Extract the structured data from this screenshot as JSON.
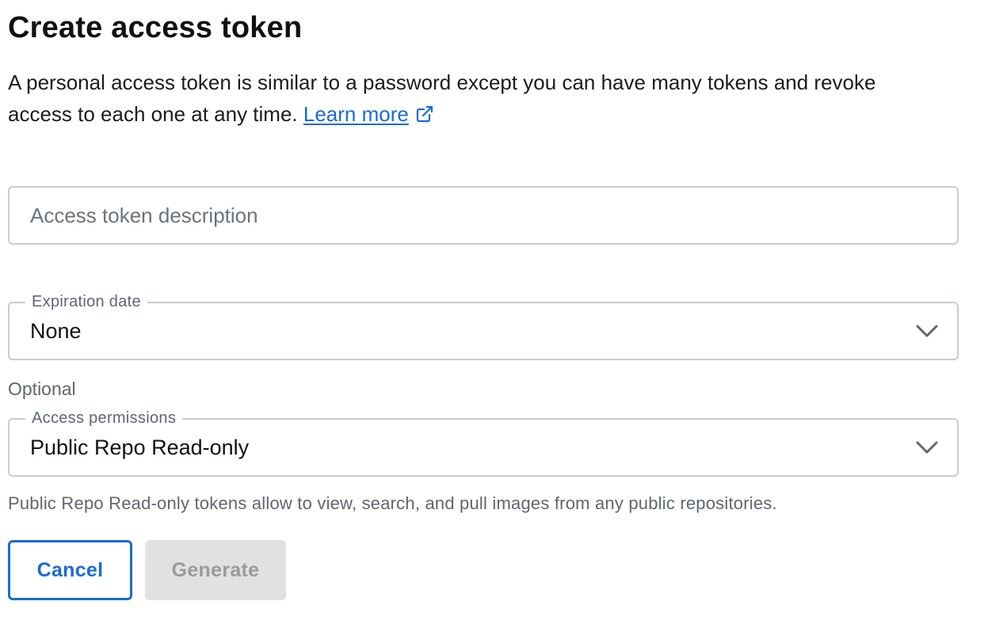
{
  "header": {
    "title": "Create access token"
  },
  "intro": {
    "text": "A personal access token is similar to a password except you can have many tokens and revoke access to each one at any time.",
    "link_label": "Learn more",
    "link_icon": "external-link-icon"
  },
  "form": {
    "description": {
      "placeholder": "Access token description",
      "value": ""
    },
    "expiration": {
      "label": "Expiration date",
      "value": "None",
      "icon": "chevron-down-icon"
    },
    "optional_label": "Optional",
    "permissions": {
      "label": "Access permissions",
      "value": "Public Repo Read-only",
      "icon": "chevron-down-icon",
      "helper": "Public Repo Read-only tokens allow to view, search, and pull images from any public repositories."
    }
  },
  "actions": {
    "cancel_label": "Cancel",
    "generate_label": "Generate",
    "generate_disabled": true
  },
  "colors": {
    "accent": "#1a6ad6",
    "border": "#c9ccd1",
    "muted_text": "#5f6670",
    "disabled_bg": "#e1e1e1",
    "disabled_text": "#9a9a9a"
  }
}
